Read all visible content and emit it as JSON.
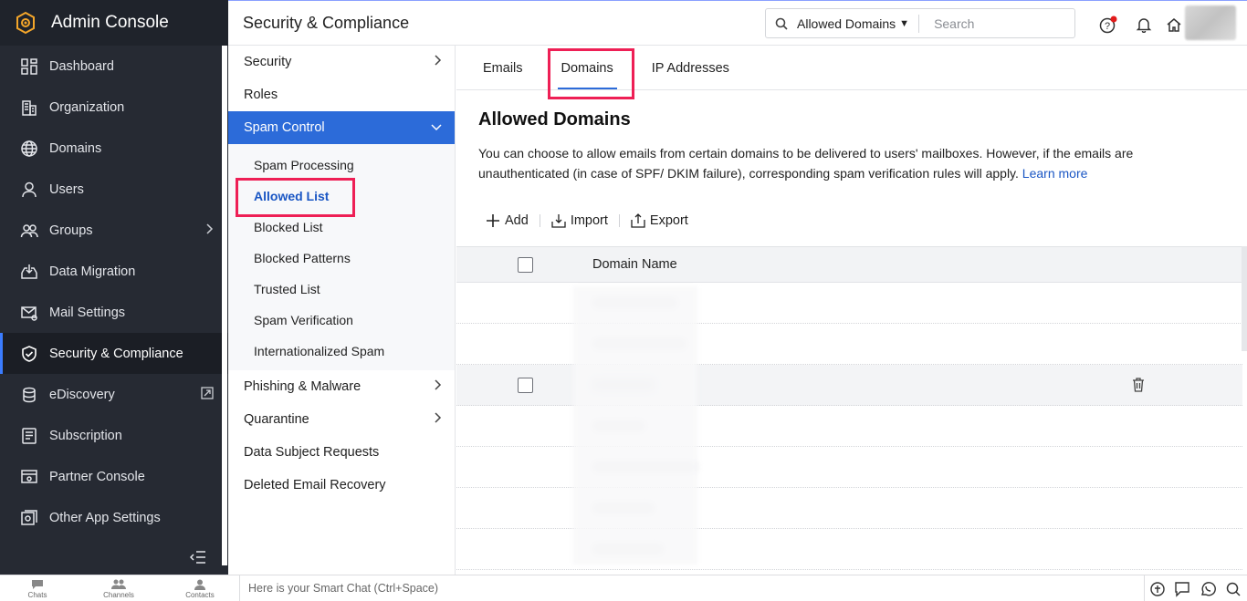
{
  "app": {
    "title": "Admin Console"
  },
  "sidebar": {
    "items": [
      {
        "label": "Dashboard",
        "icon": "dashboard-icon"
      },
      {
        "label": "Organization",
        "icon": "organization-icon"
      },
      {
        "label": "Domains",
        "icon": "globe-icon"
      },
      {
        "label": "Users",
        "icon": "user-icon"
      },
      {
        "label": "Groups",
        "icon": "groups-icon"
      },
      {
        "label": "Data Migration",
        "icon": "inbox-download-icon"
      },
      {
        "label": "Mail Settings",
        "icon": "mail-settings-icon"
      },
      {
        "label": "Security & Compliance",
        "icon": "shield-check-icon"
      },
      {
        "label": "eDiscovery",
        "icon": "ediscovery-icon"
      },
      {
        "label": "Subscription",
        "icon": "subscription-icon"
      },
      {
        "label": "Partner Console",
        "icon": "partner-console-icon"
      },
      {
        "label": "Other App Settings",
        "icon": "app-settings-icon"
      }
    ],
    "active": "Security & Compliance"
  },
  "header": {
    "title": "Security & Compliance",
    "search_scope": "Allowed Domains",
    "search_placeholder": "Search"
  },
  "submenu": {
    "security": "Security",
    "roles": "Roles",
    "spam_control": "Spam Control",
    "spam_sub": [
      "Spam Processing",
      "Allowed List",
      "Blocked List",
      "Blocked Patterns",
      "Trusted List",
      "Spam Verification",
      "Internationalized Spam"
    ],
    "phishing": "Phishing & Malware",
    "quarantine": "Quarantine",
    "dsr": "Data Subject Requests",
    "deleted_recovery": "Deleted Email Recovery"
  },
  "content": {
    "tabs": [
      "Emails",
      "Domains",
      "IP Addresses"
    ],
    "active_tab": "Domains",
    "heading": "Allowed Domains",
    "description": "You can choose to allow emails from certain domains to be delivered to users' mailboxes. However, if the emails are unauthenticated (in case of SPF/ DKIM failure), corresponding spam verification rules will apply.",
    "learn_more": "Learn more",
    "actions": {
      "add": "Add",
      "import": "Import",
      "export": "Export"
    },
    "table": {
      "column": "Domain Name"
    }
  },
  "bottombar": {
    "chats": "Chats",
    "channels": "Channels",
    "contacts": "Contacts",
    "smart_chat_placeholder": "Here is your Smart Chat (Ctrl+Space)"
  },
  "colors": {
    "accent": "#2c6bd9",
    "sidebar_bg": "#262a33",
    "highlight": "#ee1f55"
  }
}
